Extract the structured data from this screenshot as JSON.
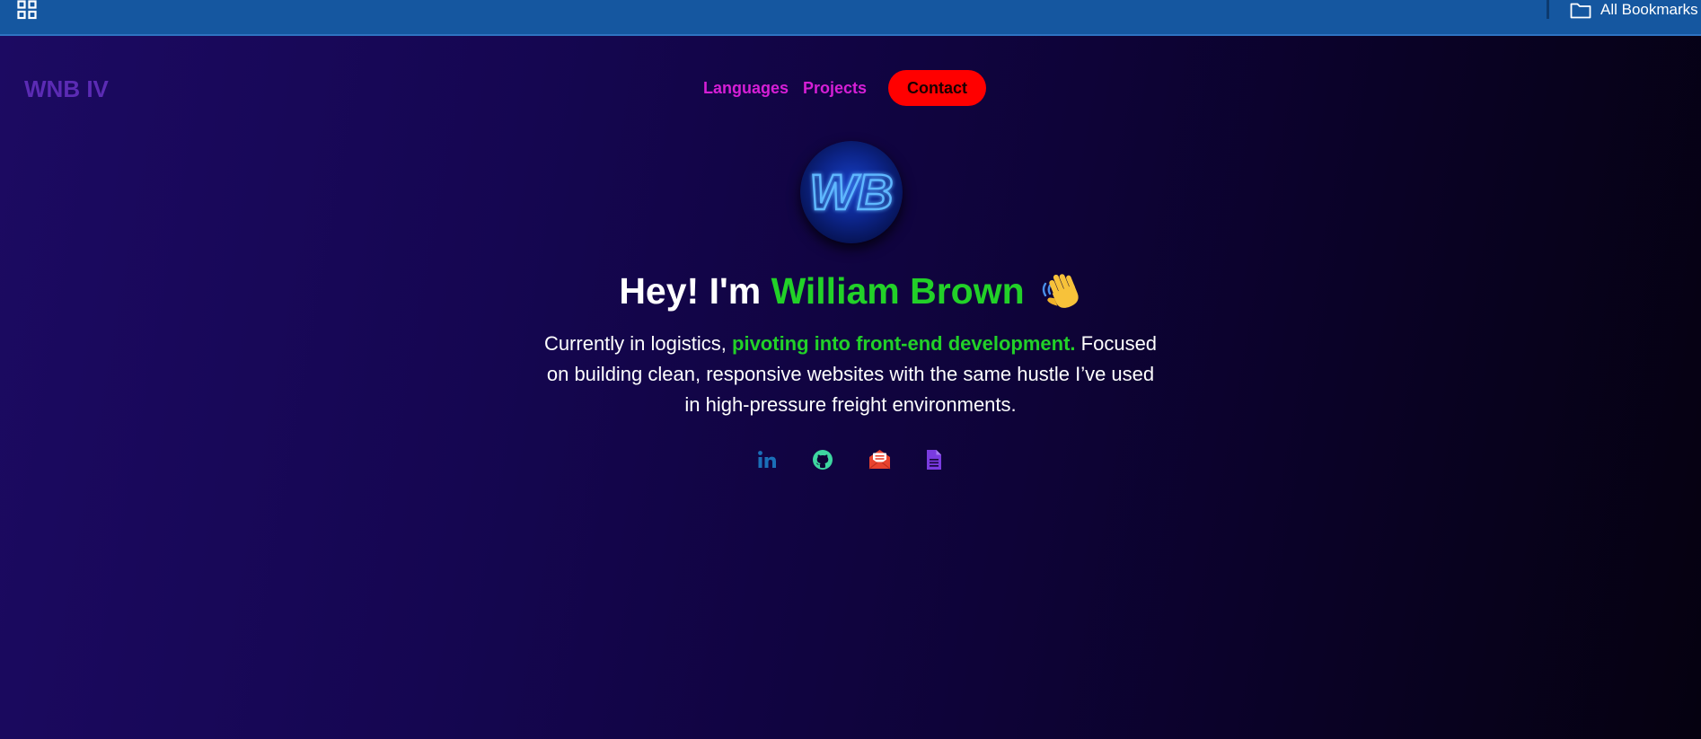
{
  "browser": {
    "bookmarks_bar": {
      "folder_label": "All Bookmarks"
    }
  },
  "site": {
    "logo": "WNB IV",
    "nav": {
      "languages": "Languages",
      "projects": "Projects",
      "contact": "Contact"
    }
  },
  "hero": {
    "avatar_text": "WB",
    "greeting": "Hey! I'm ",
    "name": "William Brown",
    "description": {
      "part1": "Currently in logistics, ",
      "highlight": "pivoting into front-end development.",
      "part2": " Focused on building clean, responsive websites with the same hustle I’ve used in high-pressure freight environments."
    },
    "social_links": [
      {
        "name": "linkedin",
        "icon": "linkedin-icon",
        "color": "#1a6fb8"
      },
      {
        "name": "github",
        "icon": "github-icon",
        "color": "#3ed6a0"
      },
      {
        "name": "email",
        "icon": "envelope-icon",
        "color": "#e8432f"
      },
      {
        "name": "resume",
        "icon": "document-icon",
        "color": "#7a3be0"
      }
    ]
  },
  "colors": {
    "bookmarks_bar": "#1557a0",
    "logo": "#5b2bb4",
    "nav_link": "#d61fd6",
    "contact_button": "#ff0000",
    "accent_green": "#22d128",
    "background_start": "#1c0a62",
    "background_end": "#050110"
  }
}
